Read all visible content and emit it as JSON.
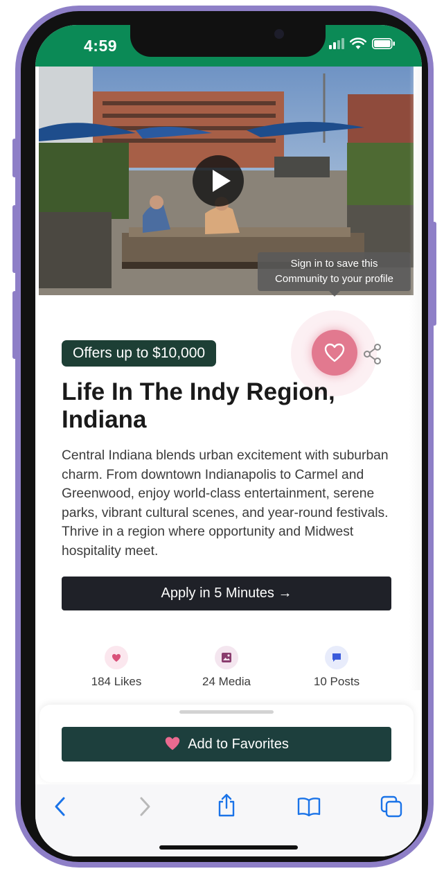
{
  "status_bar": {
    "time": "4:59"
  },
  "hero": {
    "tooltip_line1": "Sign in to save this",
    "tooltip_line2": "Community to your profile"
  },
  "community": {
    "offer": "Offers up to $10,000",
    "title": "Life In The Indy Region, Indiana",
    "description": "Central Indiana blends urban excitement with suburban charm. From downtown Indianapolis to Carmel and Greenwood, enjoy world-class entertainment, serene parks, vibrant cultural scenes, and year-round festivals. Thrive in a region where opportunity and Midwest hospitality meet.",
    "apply_label": "Apply in 5 Minutes →"
  },
  "stats": [
    {
      "label": "184 Likes",
      "icon": "heart-icon",
      "color": "#d9527a",
      "bg": "#fbe7ee"
    },
    {
      "label": "24 Media",
      "icon": "image-icon",
      "color": "#8a3d6e",
      "bg": "#f4e6ef"
    },
    {
      "label": "10 Posts",
      "icon": "chat-icon",
      "color": "#3b5bdb",
      "bg": "#e8ecfb"
    }
  ],
  "sheet": {
    "favorites_label": "Add to Favorites"
  },
  "toolbar": {
    "icons": [
      "back-icon",
      "forward-icon",
      "share-icon",
      "bookmarks-icon",
      "tabs-icon"
    ]
  },
  "colors": {
    "status_green": "#0b8a56",
    "badge_green": "#1d3f35",
    "heart_pink": "#e2798f",
    "link_blue": "#1a73e8"
  }
}
